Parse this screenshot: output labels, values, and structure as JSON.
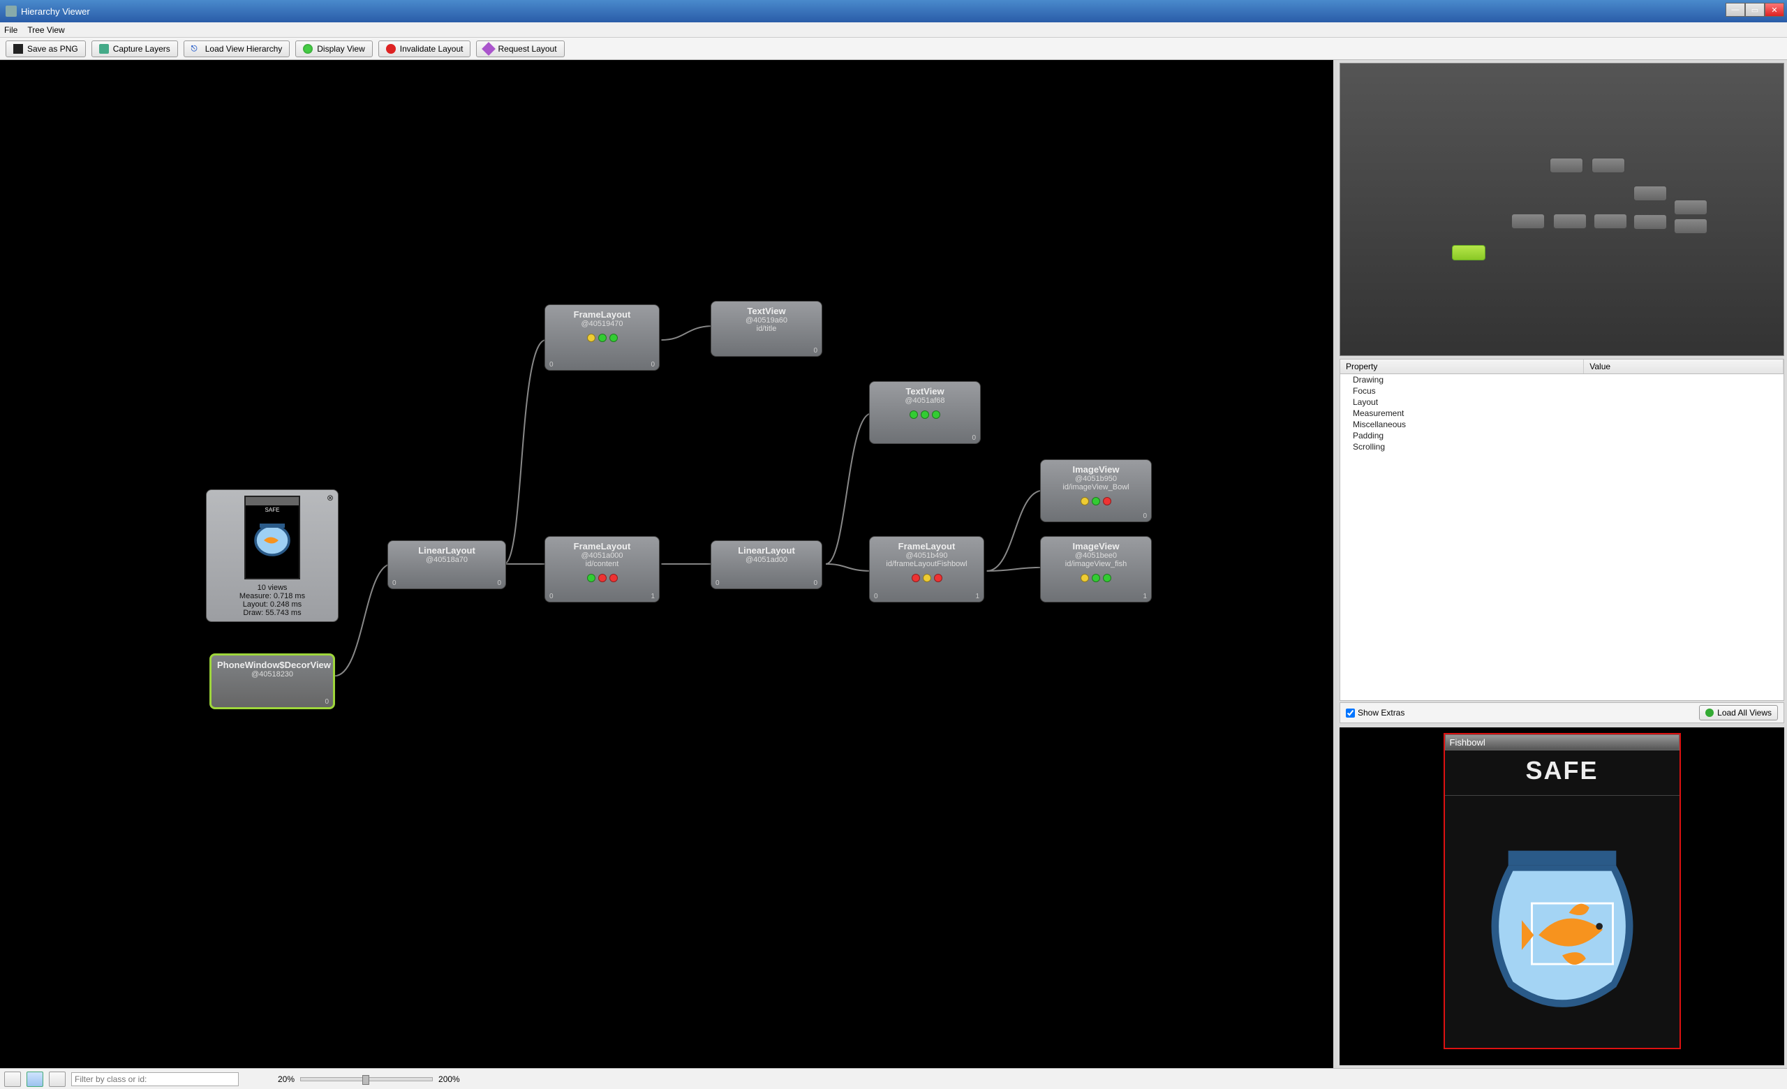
{
  "window": {
    "title": "Hierarchy Viewer"
  },
  "menu": {
    "file": "File",
    "treeview": "Tree View"
  },
  "toolbar": {
    "save": "Save as PNG",
    "capture": "Capture Layers",
    "load": "Load View Hierarchy",
    "display": "Display View",
    "invalidate": "Invalidate Layout",
    "request": "Request Layout"
  },
  "nodes": {
    "decor": {
      "title": "PhoneWindow$DecorView",
      "addr": "@40518230",
      "left": "",
      "right": "0"
    },
    "lin1": {
      "title": "LinearLayout",
      "addr": "@40518a70",
      "left": "0",
      "right": "0"
    },
    "frame1": {
      "title": "FrameLayout",
      "addr": "@40519470",
      "left": "0",
      "right": "0",
      "dots": [
        "y",
        "g",
        "g"
      ]
    },
    "tvTitle": {
      "title": "TextView",
      "addr": "@40519a60",
      "id": "id/title",
      "left": "",
      "right": "0"
    },
    "frame2": {
      "title": "FrameLayout",
      "addr": "@4051a000",
      "id": "id/content",
      "left": "0",
      "right": "1",
      "dots": [
        "g",
        "r",
        "r"
      ]
    },
    "lin2": {
      "title": "LinearLayout",
      "addr": "@4051ad00",
      "left": "0",
      "right": "0"
    },
    "tv2": {
      "title": "TextView",
      "addr": "@4051af68",
      "left": "",
      "right": "0",
      "dots": [
        "g",
        "g",
        "g"
      ]
    },
    "frame3": {
      "title": "FrameLayout",
      "addr": "@4051b490",
      "id": "id/frameLayoutFishbowl",
      "left": "0",
      "right": "1",
      "dots": [
        "r",
        "y",
        "r"
      ]
    },
    "ivBowl": {
      "title": "ImageView",
      "addr": "@4051b950",
      "id": "id/imageView_Bowl",
      "left": "",
      "right": "0",
      "dots": [
        "y",
        "g",
        "r"
      ]
    },
    "ivFish": {
      "title": "ImageView",
      "addr": "@4051bee0",
      "id": "id/imageView_fish",
      "left": "",
      "right": "1",
      "dots": [
        "y",
        "g",
        "g"
      ]
    }
  },
  "popup": {
    "views": "10 views",
    "measure": "Measure: 0.718 ms",
    "layout": "Layout: 0.248 ms",
    "draw": "Draw: 55.743 ms",
    "safe": "SAFE"
  },
  "props": {
    "head_property": "Property",
    "head_value": "Value",
    "rows": [
      "Drawing",
      "Focus",
      "Layout",
      "Measurement",
      "Miscellaneous",
      "Padding",
      "Scrolling"
    ]
  },
  "extras": {
    "checkbox": "Show Extras",
    "loadall": "Load All Views"
  },
  "preview": {
    "title": "Fishbowl",
    "safe": "SAFE"
  },
  "statusbar": {
    "filter_placeholder": "Filter by class or id:",
    "zoom_min": "20%",
    "zoom_max": "200%"
  }
}
